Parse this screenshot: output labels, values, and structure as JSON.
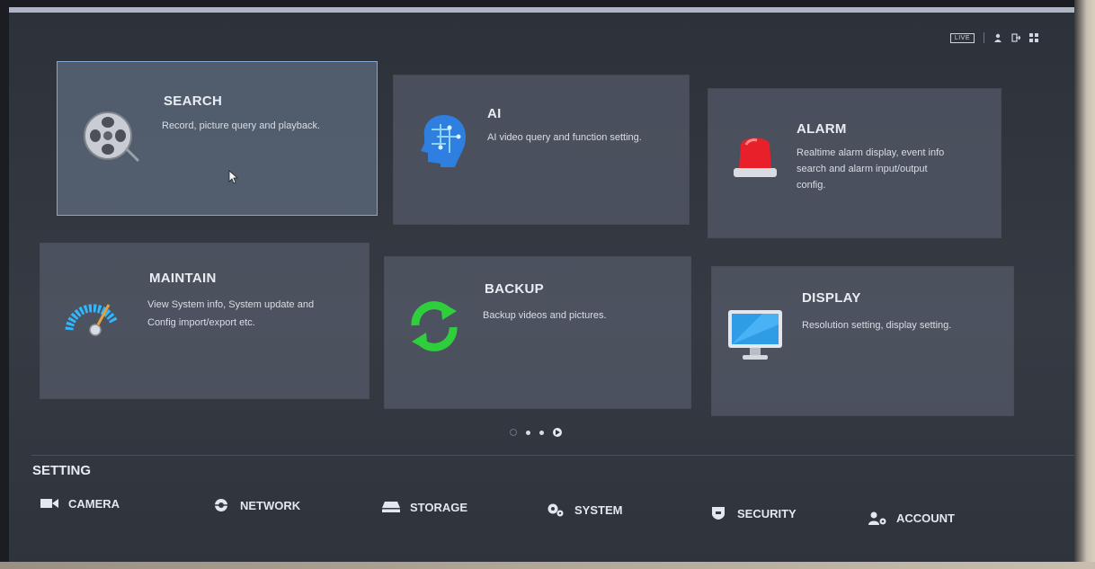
{
  "topbar": {
    "live_label": "LIVE",
    "icons": [
      "user-icon",
      "logout-icon",
      "grid-icon"
    ]
  },
  "tiles": [
    {
      "title": "SEARCH",
      "desc": "Record, picture query and playback.",
      "icon": "film-reel-icon",
      "selected": true
    },
    {
      "title": "AI",
      "desc": "AI video query and function setting.",
      "icon": "ai-head-icon"
    },
    {
      "title": "ALARM",
      "desc_lines": [
        "Realtime alarm display, event info",
        "search and alarm input/output",
        "config."
      ],
      "icon": "alarm-light-icon"
    },
    {
      "title": "MAINTAIN",
      "desc_lines": [
        "View System info, System update and",
        "Config import/export etc."
      ],
      "icon": "gauge-icon"
    },
    {
      "title": "BACKUP",
      "desc": "Backup videos and pictures.",
      "icon": "backup-arrows-icon"
    },
    {
      "title": "DISPLAY",
      "desc": "Resolution setting, display setting.",
      "icon": "monitor-icon"
    }
  ],
  "pager": {
    "pages": 3,
    "current": 2
  },
  "setting": {
    "title": "SETTING",
    "items": [
      {
        "label": "CAMERA",
        "icon": "camera-icon"
      },
      {
        "label": "NETWORK",
        "icon": "network-icon"
      },
      {
        "label": "STORAGE",
        "icon": "storage-icon"
      },
      {
        "label": "SYSTEM",
        "icon": "gears-icon"
      },
      {
        "label": "SECURITY",
        "icon": "shield-icon"
      },
      {
        "label": "ACCOUNT",
        "icon": "account-icon"
      }
    ]
  },
  "colors": {
    "accent_border": "#7fa8d8",
    "ai_blue": "#2f7fe0",
    "alarm_red": "#e8202a",
    "backup_green": "#2fce3c",
    "gauge_blue": "#2fb8ff"
  }
}
